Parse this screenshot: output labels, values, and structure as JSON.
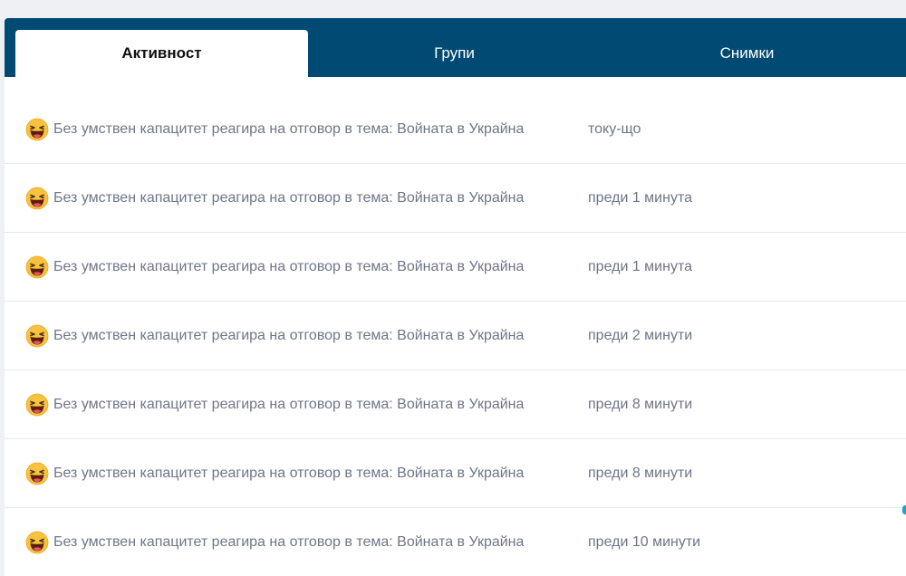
{
  "tabs": [
    {
      "label": "Активност",
      "active": true
    },
    {
      "label": "Групи",
      "active": false
    },
    {
      "label": "Снимки",
      "active": false
    }
  ],
  "activity_rows": [
    {
      "text": "Без умствен капацитет реагира на отговор в тема: Войната в Украйна",
      "time": "току-що",
      "icon": "laughing-emoji-icon"
    },
    {
      "text": "Без умствен капацитет реагира на отговор в тема: Войната в Украйна",
      "time": "преди 1 минута",
      "icon": "laughing-emoji-icon"
    },
    {
      "text": "Без умствен капацитет реагира на отговор в тема: Войната в Украйна",
      "time": "преди 1 минута",
      "icon": "laughing-emoji-icon"
    },
    {
      "text": "Без умствен капацитет реагира на отговор в тема: Войната в Украйна",
      "time": "преди 2 минути",
      "icon": "laughing-emoji-icon"
    },
    {
      "text": "Без умствен капацитет реагира на отговор в тема: Войната в Украйна",
      "time": "преди 8 минути",
      "icon": "laughing-emoji-icon"
    },
    {
      "text": "Без умствен капацитет реагира на отговор в тема: Войната в Украйна",
      "time": "преди 8 минути",
      "icon": "laughing-emoji-icon"
    },
    {
      "text": "Без умствен капацитет реагира на отговор в тема: Войната в Украйна",
      "time": "преди 10 минути",
      "icon": "laughing-emoji-icon"
    }
  ],
  "colors": {
    "tabbar": "#004a74",
    "text": "#6e7687",
    "accent": "#19a7c9"
  }
}
